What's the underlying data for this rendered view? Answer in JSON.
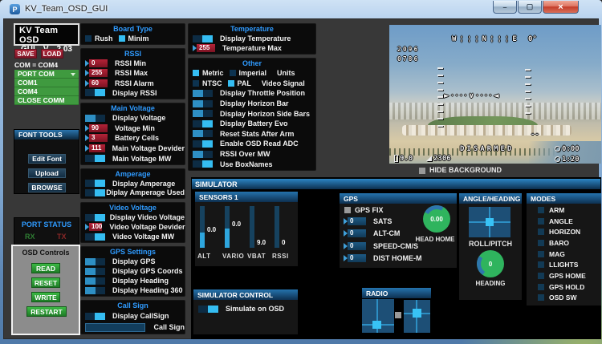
{
  "window": {
    "title": "KV_Team_OSD_GUI",
    "icon_letter": "P",
    "minimize": "–",
    "maximize": "▢",
    "close": "×"
  },
  "colors": {
    "accent_blue": "#2F9BFF",
    "toggle_on": "#35BDF2",
    "red_box": "#A01D30",
    "green_button": "#2FA336",
    "rx_green": "#2F7D33",
    "tx_red": "#8A2727"
  },
  "left": {
    "app_name": "KV Team OSD",
    "gui": "GUI",
    "v": "V",
    "version": "2.03",
    "save": "SAVE",
    "load": "LOAD",
    "com_status": "COM = COM4",
    "port_dropdown": "PORT COM",
    "port_items": [
      "COM1",
      "COM4",
      "CLOSE COMM"
    ],
    "font_tools": {
      "title": "FONT TOOLS",
      "buttons": [
        "Edit Font",
        "Upload",
        "BROWSE"
      ]
    },
    "port_status": {
      "title": "PORT STATUS",
      "rx": "RX",
      "tx": "TX"
    },
    "osd_controls": {
      "title": "OSD Controls",
      "buttons": [
        "READ",
        "RESET",
        "WRITE",
        "RESTART"
      ]
    }
  },
  "col2": {
    "board_type": {
      "title": "Board Type",
      "rows": [
        {
          "type": "checks",
          "items": [
            {
              "label": "Rush",
              "checked": false
            },
            {
              "label": "Minim",
              "checked": true
            }
          ]
        }
      ]
    },
    "rssi": {
      "title": "RSSI",
      "rows": [
        {
          "type": "value",
          "box": "red",
          "value": "0",
          "label": "RSSI Min"
        },
        {
          "type": "value",
          "box": "red",
          "value": "255",
          "label": "RSSI Max"
        },
        {
          "type": "value",
          "box": "red",
          "value": "60",
          "label": "RSSI Alarm"
        },
        {
          "type": "toggle",
          "handle": "right",
          "label": "Display RSSI"
        }
      ]
    },
    "main_voltage": {
      "title": "Main Voltage",
      "rows": [
        {
          "type": "toggle",
          "handle": "left",
          "label": "Display Voltage"
        },
        {
          "type": "value",
          "box": "red",
          "value": "90",
          "label": "Voltage Min"
        },
        {
          "type": "value",
          "box": "red",
          "value": "3",
          "label": "Battery Cells"
        },
        {
          "type": "value",
          "box": "red",
          "value": "111",
          "label": "Main Voltage Devider"
        },
        {
          "type": "toggle",
          "handle": "right",
          "label": "Main Voltage MW"
        }
      ]
    },
    "amperage": {
      "title": "Amperage",
      "rows": [
        {
          "type": "toggle",
          "handle": "right",
          "label": "Display Amperage"
        },
        {
          "type": "toggle",
          "handle": "right",
          "label": "Diplay Amperage Used"
        }
      ]
    },
    "video_voltage": {
      "title": "Video Voltage",
      "rows": [
        {
          "type": "toggle",
          "handle": "right",
          "label": "Display Video Voltage"
        },
        {
          "type": "value",
          "box": "red",
          "value": "100",
          "label": "Video Voltage Devider"
        },
        {
          "type": "toggle",
          "handle": "right",
          "label": "Video Voltage MW"
        }
      ]
    },
    "gps_settings": {
      "title": "GPS Settings",
      "rows": [
        {
          "type": "toggle",
          "handle": "left",
          "label": "Display GPS"
        },
        {
          "type": "toggle",
          "handle": "left",
          "label": "Display GPS Coords"
        },
        {
          "type": "toggle",
          "handle": "left",
          "label": "Display Heading"
        },
        {
          "type": "toggle",
          "handle": "left",
          "label": "Display Heading 360"
        }
      ]
    },
    "call_sign": {
      "title": "Call Sign",
      "rows": [
        {
          "type": "toggle",
          "handle": "right",
          "label": "Display CallSign"
        },
        {
          "type": "input",
          "value": "",
          "label": "Call Sign"
        }
      ]
    }
  },
  "col3": {
    "temperature": {
      "title": "Temperature",
      "rows": [
        {
          "type": "toggle",
          "handle": "right",
          "label": "Display Temperature"
        },
        {
          "type": "value",
          "box": "red",
          "value": "255",
          "label": "Temperature Max"
        }
      ]
    },
    "other": {
      "title": "Other",
      "rows": [
        {
          "type": "checks",
          "items": [
            {
              "label": "Metric",
              "checked": true
            },
            {
              "label": "Imperial",
              "checked": false
            }
          ],
          "suffix": "Units"
        },
        {
          "type": "checks",
          "items": [
            {
              "label": "NTSC",
              "checked": false
            },
            {
              "label": "PAL",
              "checked": true
            }
          ],
          "suffix": "Video Signal"
        },
        {
          "type": "toggle",
          "handle": "left",
          "label": "Display Throttle Position"
        },
        {
          "type": "toggle",
          "handle": "left",
          "label": "Display Horizon Bar"
        },
        {
          "type": "toggle",
          "handle": "left",
          "label": "Display Horizon Side Bars"
        },
        {
          "type": "toggle",
          "handle": "right",
          "label": "Display Battery Evo"
        },
        {
          "type": "toggle",
          "handle": "left",
          "label": "Reset Stats After Arm"
        },
        {
          "type": "toggle",
          "handle": "right",
          "label": "Enable OSD Read ADC"
        },
        {
          "type": "toggle",
          "handle": "left",
          "label": "RSSI Over MW"
        },
        {
          "type": "toggle",
          "handle": "right",
          "label": "Use BoxNames"
        }
      ]
    }
  },
  "preview": {
    "hide_label": "HIDE BACKGROUND",
    "osd": {
      "compass": "W¦¦¦N¦¦¦E",
      "degrees": "0°",
      "left_lines": [
        "2096",
        "0786"
      ],
      "horizon": "►····∨····◄",
      "marks": "--",
      "status": "DISARMED",
      "flight_timer": "0:00",
      "on_timer": "1:20",
      "voltage": "9.0",
      "counter": "2306"
    }
  },
  "sim": {
    "title": "SIMULATOR",
    "sensors": {
      "title": "SENSORS 1",
      "sliders": [
        {
          "label": "ALT",
          "value": "0.0",
          "fill": 0.36,
          "pos": 0.375
        },
        {
          "label": "VARIO",
          "value": "0.0",
          "fill": 0.47,
          "pos": 0.5
        },
        {
          "label": "VBAT",
          "value": "9.0",
          "fill": 0,
          "pos": 0.06
        },
        {
          "label": "RSSI",
          "value": "0",
          "fill": 0,
          "pos": 0.06
        }
      ]
    },
    "gps": {
      "title": "GPS",
      "fix_label": "GPS FIX",
      "knob_value": "0.00",
      "knob_label": "HEAD HOME"
    },
    "gps_rows": {
      "rows": [
        {
          "type": "value",
          "box": "blue",
          "value": "0",
          "label": "SATS"
        },
        {
          "type": "value",
          "box": "blue",
          "value": "0",
          "label": "ALT-CM"
        },
        {
          "type": "value",
          "box": "blue",
          "value": "0",
          "label": "SPEED-CM/S"
        },
        {
          "type": "value",
          "box": "blue",
          "value": "0",
          "label": "DIST HOME-M"
        }
      ]
    },
    "angle": {
      "title": "ANGLE/HEADING",
      "pad_label": "ROLL/PITCH",
      "knob_value": "0",
      "knob_label": "HEADING"
    },
    "modes": {
      "title": "MODES",
      "items": [
        "ARM",
        "ANGLE",
        "HORIZON",
        "BARO",
        "MAG",
        "LLIGHTS",
        "GPS HOME",
        "GPS HOLD",
        "OSD SW"
      ]
    },
    "control": {
      "title": "SIMULATOR CONTROL",
      "toggle_label": "Simulate on OSD"
    },
    "radio": {
      "title": "RADIO"
    }
  }
}
